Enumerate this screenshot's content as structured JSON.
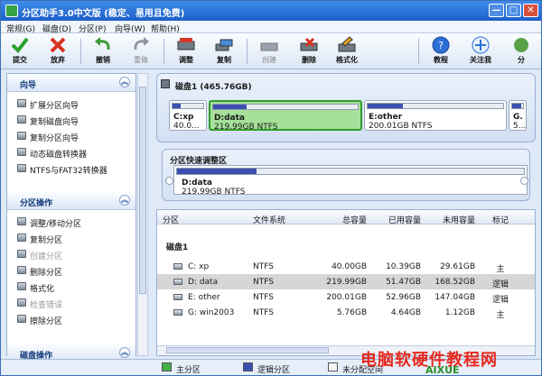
{
  "window": {
    "title": "分区助手3.0中文版 (稳定、易用且免费)",
    "min": "—",
    "max": "□",
    "close": "✕"
  },
  "menu": [
    {
      "label": "常规(G)"
    },
    {
      "label": "磁盘(D)"
    },
    {
      "label": "分区(P)"
    },
    {
      "label": "向导(W)"
    },
    {
      "label": "帮助(H)"
    }
  ],
  "toolbar": [
    {
      "label": "提交",
      "icon": "check-icon",
      "disabled": false
    },
    {
      "label": "放弃",
      "icon": "x-icon",
      "disabled": false
    },
    {
      "label": "撤销",
      "icon": "undo-icon",
      "disabled": false
    },
    {
      "label": "重做",
      "icon": "redo-icon",
      "disabled": true
    },
    {
      "label": "调整",
      "icon": "resize-icon",
      "disabled": false
    },
    {
      "label": "复制",
      "icon": "copy-icon",
      "disabled": false
    },
    {
      "label": "创建",
      "icon": "create-icon",
      "disabled": true
    },
    {
      "label": "删除",
      "icon": "delete-icon",
      "disabled": false
    },
    {
      "label": "格式化",
      "icon": "format-icon",
      "disabled": false
    },
    {
      "label": "教程",
      "icon": "help-icon",
      "disabled": false
    },
    {
      "label": "关注我",
      "icon": "follow-icon",
      "disabled": false
    },
    {
      "label": "分",
      "icon": "more-icon",
      "disabled": false
    }
  ],
  "sidebar": {
    "wizard": {
      "title": "向导",
      "items": [
        {
          "label": "扩展分区向导"
        },
        {
          "label": "复制磁盘向导"
        },
        {
          "label": "复制分区向导"
        },
        {
          "label": "动态磁盘转换器"
        },
        {
          "label": "NTFS与FAT32转换器"
        }
      ]
    },
    "partition_ops": {
      "title": "分区操作",
      "items": [
        {
          "label": "调整/移动分区",
          "disabled": false
        },
        {
          "label": "复制分区",
          "disabled": false
        },
        {
          "label": "创建分区",
          "disabled": true
        },
        {
          "label": "删除分区",
          "disabled": false
        },
        {
          "label": "格式化",
          "disabled": false
        },
        {
          "label": "检查错误",
          "disabled": true
        },
        {
          "label": "擦除分区",
          "disabled": false
        }
      ]
    },
    "disk_ops": {
      "title": "磁盘操作"
    }
  },
  "disk_map": {
    "title": "磁盘1  (465.76GB)",
    "partitions": [
      {
        "name": "C:xp",
        "size": "40.0...",
        "used_ratio": 0.26
      },
      {
        "name": "D:data",
        "size": "219.99GB NTFS",
        "used_ratio": 0.23
      },
      {
        "name": "E:other",
        "size": "200.01GB NTFS",
        "used_ratio": 0.26
      },
      {
        "name": "G.",
        "size": "5...",
        "used_ratio": 0.8
      }
    ]
  },
  "quick_resize": {
    "title": "分区快速调整区",
    "partition": "D:data",
    "size": "219.99GB NTFS",
    "used_ratio": 0.23
  },
  "table": {
    "headers": [
      "分区",
      "文件系统",
      "总容量",
      "已用容量",
      "未用容量",
      "标记"
    ],
    "disk_label": "磁盘1",
    "rows": [
      {
        "partition": "C:  xp",
        "fs": "NTFS",
        "total": "40.00GB",
        "used": "10.39GB",
        "free": "29.61GB",
        "flag": "主"
      },
      {
        "partition": "D:  data",
        "fs": "NTFS",
        "total": "219.99GB",
        "used": "51.47GB",
        "free": "168.52GB",
        "flag": "逻辑"
      },
      {
        "partition": "E:  other",
        "fs": "NTFS",
        "total": "200.01GB",
        "used": "52.96GB",
        "free": "147.04GB",
        "flag": "逻辑"
      },
      {
        "partition": "G:  win2003",
        "fs": "NTFS",
        "total": "5.76GB",
        "used": "4.64GB",
        "free": "1.12GB",
        "flag": "主"
      }
    ]
  },
  "status": {
    "primary": "主分区",
    "logical": "逻辑分区",
    "unallocated": "未分配空间"
  },
  "watermark": {
    "cn": "电脑软硬件教程网",
    "en": "AIXUE"
  }
}
